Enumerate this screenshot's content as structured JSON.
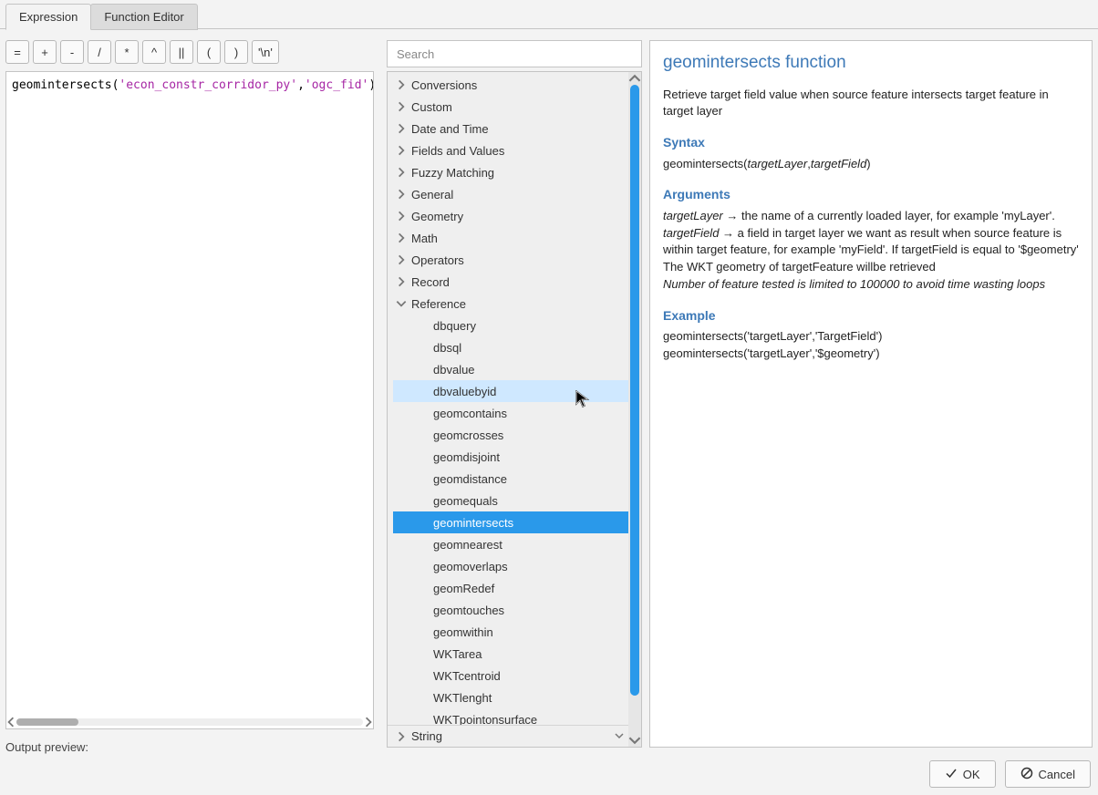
{
  "tabs": {
    "expression": "Expression",
    "function_editor": "Function Editor",
    "active": "expression"
  },
  "operators": [
    "=",
    "+",
    "-",
    "/",
    "*",
    "^",
    "||",
    "(",
    ")",
    "'\\n'"
  ],
  "expression": {
    "fn": "geomintersects",
    "open": "(",
    "arg1": "'econ_constr_corridor_py'",
    "comma": ",",
    "arg2": "'ogc_fid'",
    "close": ")"
  },
  "search": {
    "placeholder": "Search"
  },
  "output_preview_label": "Output preview:",
  "tree": {
    "categories": [
      {
        "label": "Conversions",
        "expanded": false
      },
      {
        "label": "Custom",
        "expanded": false
      },
      {
        "label": "Date and Time",
        "expanded": false
      },
      {
        "label": "Fields and Values",
        "expanded": false
      },
      {
        "label": "Fuzzy Matching",
        "expanded": false
      },
      {
        "label": "General",
        "expanded": false
      },
      {
        "label": "Geometry",
        "expanded": false
      },
      {
        "label": "Math",
        "expanded": false
      },
      {
        "label": "Operators",
        "expanded": false
      },
      {
        "label": "Record",
        "expanded": false
      },
      {
        "label": "Reference",
        "expanded": true,
        "children": [
          "dbquery",
          "dbsql",
          "dbvalue",
          "dbvaluebyid",
          "geomcontains",
          "geomcrosses",
          "geomdisjoint",
          "geomdistance",
          "geomequals",
          "geomintersects",
          "geomnearest",
          "geomoverlaps",
          "geomRedef",
          "geomtouches",
          "geomwithin",
          "WKTarea",
          "WKTcentroid",
          "WKTlenght",
          "WKTpointonsurface"
        ]
      },
      {
        "label": "String",
        "expanded": false
      }
    ],
    "hover_leaf": "dbvaluebyid",
    "selected_leaf": "geomintersects"
  },
  "help": {
    "title": "geomintersects function",
    "desc": "Retrieve target field value when source feature intersects target feature in target layer",
    "syntax_h": "Syntax",
    "syntax_fn": "geomintersects(",
    "syntax_a1": "targetLayer",
    "syntax_sep": ",",
    "syntax_a2": "targetField",
    "syntax_close": ")",
    "args_h": "Arguments",
    "arg1_name": "targetLayer",
    "arg1_desc": " → the name of a currently loaded layer, for example 'myLayer'.",
    "arg2_name": "targetField",
    "arg2_desc": " → a field in target layer we want as result when source feature is within target feature, for example 'myField'. If targetField is equal to '$geometry' The WKT geometry of targetFeature willbe retrieved",
    "args_note": "Number of feature tested is limited to 100000 to avoid time wasting loops",
    "example_h": "Example",
    "example1": "geomintersects('targetLayer','TargetField')",
    "example2": "geomintersects('targetLayer','$geometry')"
  },
  "buttons": {
    "ok": "OK",
    "cancel": "Cancel"
  }
}
